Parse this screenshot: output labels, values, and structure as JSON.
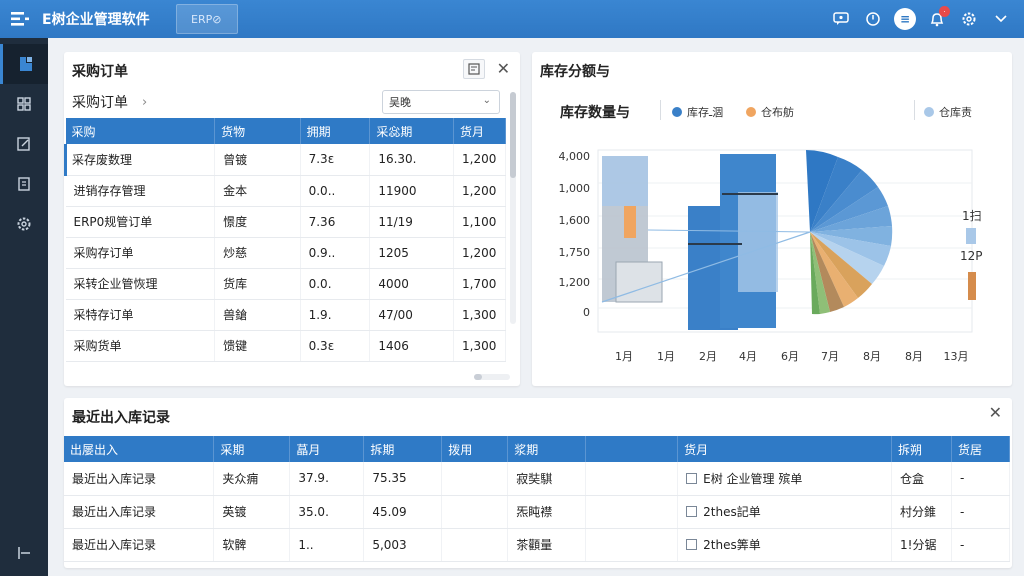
{
  "topbar": {
    "title": "E树企业管理软件",
    "tab": "ERP⊘"
  },
  "orders": {
    "title": "采购订单",
    "subtitle": "采购订单",
    "select_value": "吴晚",
    "columns": [
      "采购",
      "货物",
      "拥期",
      "采惢期",
      "货月"
    ],
    "rows": [
      [
        "采存废数理",
        "曾镀",
        "7.3ε",
        "16.30.",
        "1,200"
      ],
      [
        "进销存存管理",
        "金本",
        "0.0..",
        "11900",
        "1,200"
      ],
      [
        "ERP0规管订单",
        "憬度",
        "7.36",
        "11/19",
        "1,100"
      ],
      [
        "采购存订单",
        "炒慈",
        "0.9..",
        "1205",
        "1,200"
      ],
      [
        "采转企业管恢理",
        "货库",
        "0.0.",
        "4000",
        "1,700"
      ],
      [
        "采特存订单",
        "兽鎗",
        "1.9.",
        "47/00",
        "1,300"
      ],
      [
        "采购货单",
        "馈键",
        "0.3ε",
        "1406",
        "1,300"
      ]
    ]
  },
  "chart": {
    "title": "库存分额与",
    "subtitle": "库存数量与",
    "legend": [
      {
        "label": "库存ـ涸",
        "color": "#3a80c8"
      },
      {
        "label": "仓布舫",
        "color": "#f0a560"
      },
      {
        "label": "仓库责",
        "color": "#a9c8e8"
      }
    ],
    "side_labels": [
      "1扫",
      "12P"
    ]
  },
  "chart_data": {
    "type": "bar",
    "categories": [
      "1月",
      "1月",
      "2月",
      "4月",
      "6月",
      "7月",
      "8月",
      "8月",
      "13月"
    ],
    "ytick_labels": [
      "4,000",
      "1,000",
      "1,600",
      "1,750",
      "1,200",
      "0"
    ]
  },
  "records": {
    "title": "最近出入库记录",
    "columns": [
      "出屡出入",
      "采期",
      "蕌月",
      "拆期",
      "拨用",
      "浆期",
      "",
      "货月",
      "拆朔",
      "货居"
    ],
    "rows": [
      [
        "最近出入库记录",
        "夹众痈",
        "37.9.",
        "75.35",
        "",
        "寂奘騏",
        "",
        "E树 企业管理 殡单",
        "仓盒",
        "-"
      ],
      [
        "最近出入库记录",
        "英镀",
        "35.0.",
        "45.09",
        "",
        "炁盹襟",
        "",
        "2thes記单",
        "村分錐",
        "-"
      ],
      [
        "最近出入库记录",
        "软髀",
        "1..",
        "5,003",
        "",
        "茶顴量",
        "",
        "2thes筭单",
        "1!分锯",
        "-"
      ]
    ]
  }
}
